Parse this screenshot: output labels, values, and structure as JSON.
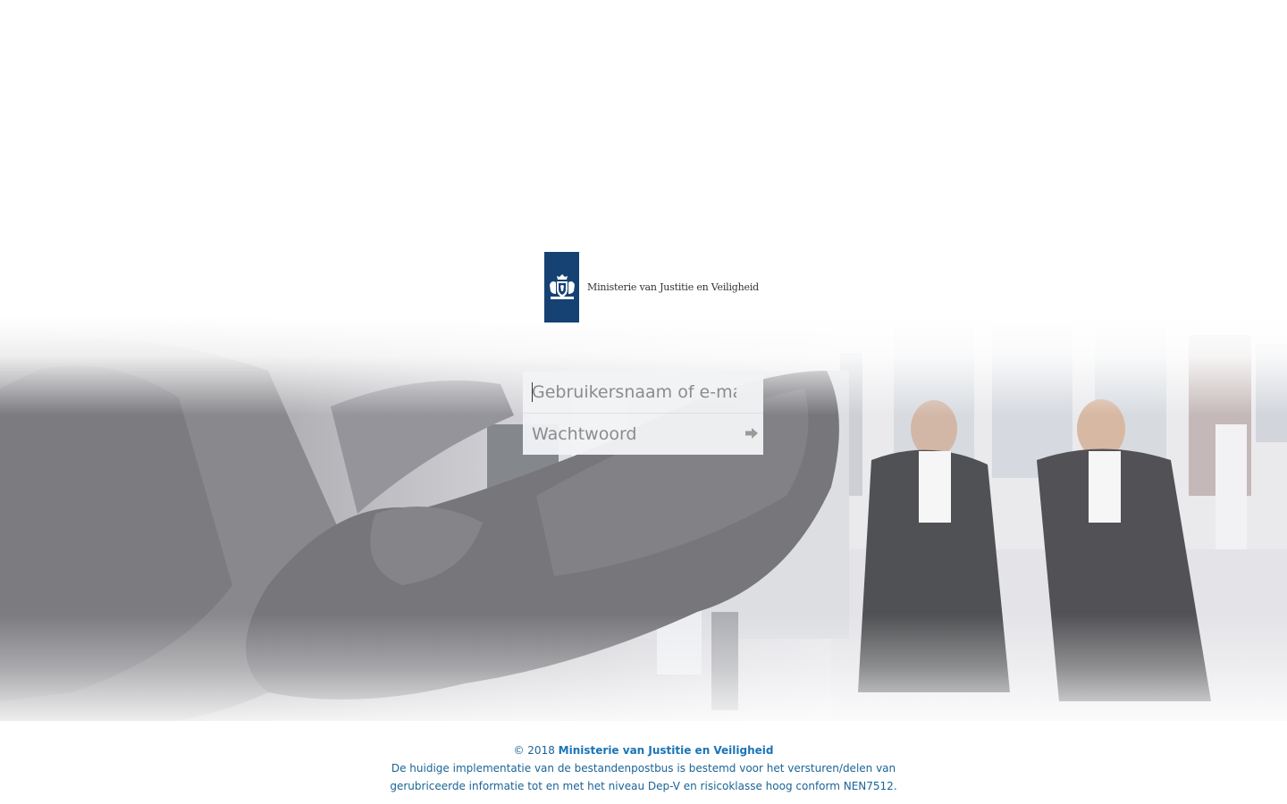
{
  "logo": {
    "text": "Ministerie van Justitie en Veiligheid",
    "block_color": "#154273"
  },
  "login": {
    "username_placeholder": "Gebruikersnaam of e-mail",
    "username_value": "",
    "password_placeholder": "Wachtwoord",
    "password_value": "",
    "submit_icon": "arrow-right-icon"
  },
  "footer": {
    "copyright": "© 2018",
    "org_link": "Ministerie van Justitie en Veiligheid",
    "notice": "De huidige implementatie van de bestandenpostbus is bestemd voor het versturen/delen van gerubriceerde informatie tot en met het niveau Dep-V en risicoklasse hoog conform NEN7512.",
    "text_color": "#1a6496",
    "link_color": "#1a74b6"
  },
  "background": {
    "image": "bronze sculpture of hand with two lawyers in robes",
    "form_field_color": "#f1f3f5"
  }
}
